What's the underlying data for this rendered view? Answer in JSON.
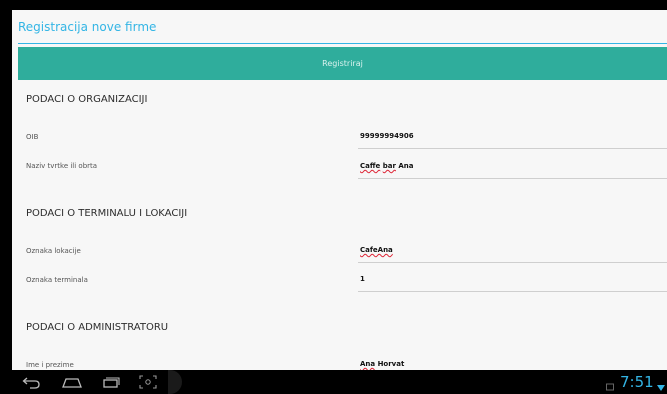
{
  "app": {
    "title": "Registracija nove firme",
    "register_button": "Registriraj"
  },
  "sections": {
    "organization": {
      "header": "PODACI O ORGANIZACIJI",
      "fields": [
        {
          "label": "OIB",
          "value": "99999994906"
        },
        {
          "label": "Naziv tvrtke ili obrta",
          "value_part1": "Caffe",
          "value_part2": "bar",
          "value_part3": "Ana"
        }
      ]
    },
    "terminal": {
      "header": "PODACI O TERMINALU I LOKACIJI",
      "fields": [
        {
          "label": "Oznaka lokacije",
          "value": "CafeAna"
        },
        {
          "label": "Oznaka terminala",
          "value": "1"
        }
      ]
    },
    "administrator": {
      "header": "PODACI O ADMINISTRATORU",
      "fields": [
        {
          "label": "Ime i prezime",
          "value_part1": "Ana",
          "value_part2": "Horvat"
        }
      ]
    }
  },
  "navbar": {
    "clock": "7:51",
    "icons": [
      "back-icon",
      "home-icon",
      "recent-apps-icon",
      "screenshot-icon"
    ]
  },
  "colors": {
    "accent": "#33b5e5",
    "button": "#2fad9c",
    "background": "#f7f7f7"
  }
}
